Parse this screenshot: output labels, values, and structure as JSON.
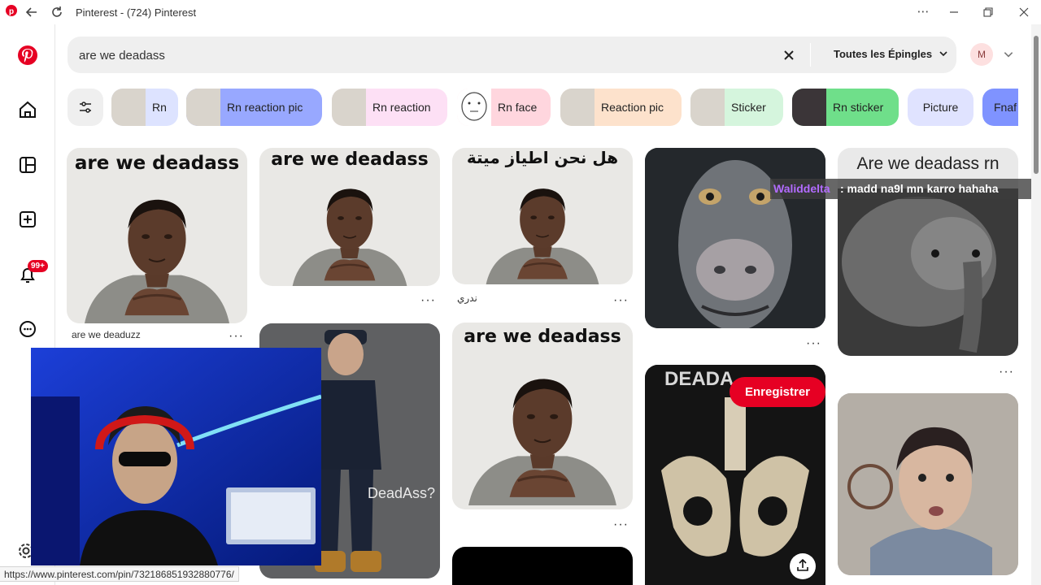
{
  "window": {
    "title": "Pinterest - (724) Pinterest"
  },
  "search": {
    "query": "are we deadass",
    "filter_label": "Toutes les Épingles",
    "avatar_letter": "M"
  },
  "rail": {
    "notification_badge": "99+"
  },
  "chips": [
    {
      "label": "Rn",
      "color": "#dde3ff"
    },
    {
      "label": "Rn reaction pic",
      "color": "#98a8ff"
    },
    {
      "label": "Rn reaction",
      "color": "#fde0f5"
    },
    {
      "label": "Rn face",
      "color": "#ffd6de"
    },
    {
      "label": "Reaction pic",
      "color": "#fde2cc"
    },
    {
      "label": "Sticker",
      "color": "#d5f5dd"
    },
    {
      "label": "Rn sticker",
      "color": "#6fdf8a"
    },
    {
      "label": "Picture",
      "color": "#e0e3ff"
    },
    {
      "label": "Fnaf",
      "color": "#7f93ff"
    }
  ],
  "pins": {
    "p1_title": "are we deadass",
    "p1_caption": "are we deaduzz",
    "p2_title": "are we deadass",
    "p3_title": "هل نحن اطياز ميتة",
    "p3_caption": "ندري",
    "p5_title": "Are we deadass rn",
    "p7_title": "are we deadass",
    "p8_partial": "DEADA",
    "p6_text": "DeadAss?",
    "save_button": "Enregistrer"
  },
  "chat": {
    "user": "Waliddelta",
    "message": ": madd na9l mn karro hahaha"
  },
  "status_url": "https://www.pinterest.com/pin/732186851932880776/",
  "dots": "···"
}
